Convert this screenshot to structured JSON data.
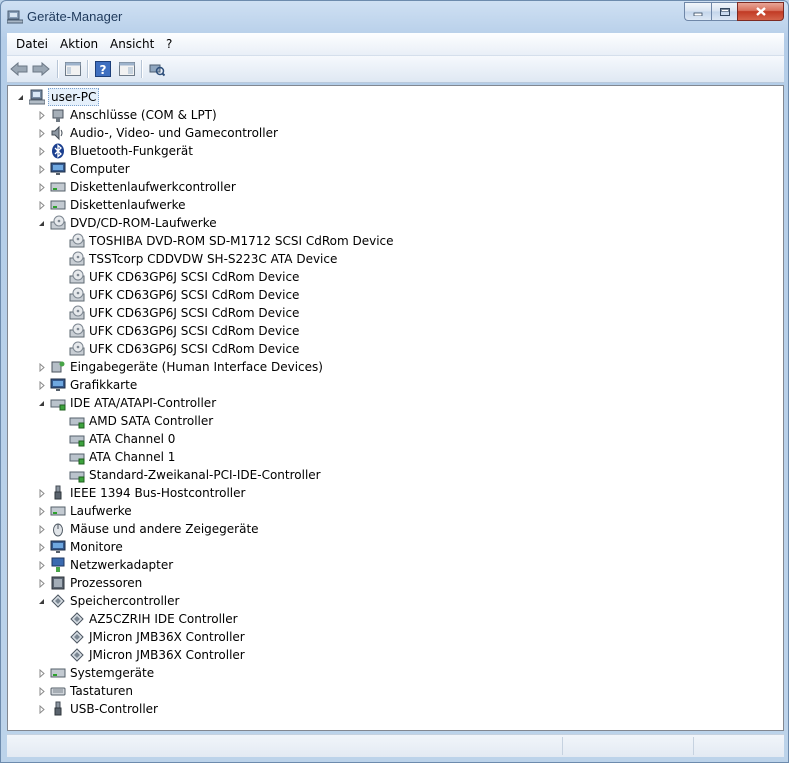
{
  "window": {
    "title": "Geräte-Manager"
  },
  "menu": [
    "Datei",
    "Aktion",
    "Ansicht",
    "?"
  ],
  "toolbar": [
    "back-icon",
    "forward-icon",
    "properties-pane-icon",
    "help-icon",
    "show-hide-console-tree-icon",
    "scan-hardware-icon"
  ],
  "tree": {
    "root": "user-PC",
    "categories": [
      {
        "label": "Anschlüsse (COM & LPT)",
        "icon": "port-icon",
        "expanded": false,
        "children": []
      },
      {
        "label": "Audio-, Video- und Gamecontroller",
        "icon": "speaker-icon",
        "expanded": false,
        "children": []
      },
      {
        "label": "Bluetooth-Funkgerät",
        "icon": "bluetooth-icon",
        "expanded": false,
        "children": []
      },
      {
        "label": "Computer",
        "icon": "computer-icon",
        "expanded": false,
        "children": []
      },
      {
        "label": "Diskettenlaufwerkcontroller",
        "icon": "floppy-controller-icon",
        "expanded": false,
        "children": []
      },
      {
        "label": "Diskettenlaufwerke",
        "icon": "floppy-drive-icon",
        "expanded": false,
        "children": []
      },
      {
        "label": "DVD/CD-ROM-Laufwerke",
        "icon": "dvd-drive-icon",
        "expanded": true,
        "children": [
          "TOSHIBA DVD-ROM SD-M1712 SCSI CdRom Device",
          "TSSTcorp CDDVDW SH-S223C ATA Device",
          "UFK CD63GP6J SCSI CdRom Device",
          "UFK CD63GP6J SCSI CdRom Device",
          "UFK CD63GP6J SCSI CdRom Device",
          "UFK CD63GP6J SCSI CdRom Device",
          "UFK CD63GP6J SCSI CdRom Device"
        ]
      },
      {
        "label": "Eingabegeräte (Human Interface Devices)",
        "icon": "hid-icon",
        "expanded": false,
        "children": []
      },
      {
        "label": "Grafikkarte",
        "icon": "display-adapter-icon",
        "expanded": false,
        "children": []
      },
      {
        "label": "IDE ATA/ATAPI-Controller",
        "icon": "ide-controller-icon",
        "expanded": true,
        "children": [
          "AMD SATA Controller",
          "ATA Channel 0",
          "ATA Channel 1",
          "Standard-Zweikanal-PCI-IDE-Controller"
        ]
      },
      {
        "label": "IEEE 1394 Bus-Hostcontroller",
        "icon": "firewire-icon",
        "expanded": false,
        "children": []
      },
      {
        "label": "Laufwerke",
        "icon": "disk-drive-icon",
        "expanded": false,
        "children": []
      },
      {
        "label": "Mäuse und andere Zeigegeräte",
        "icon": "mouse-icon",
        "expanded": false,
        "children": []
      },
      {
        "label": "Monitore",
        "icon": "monitor-icon",
        "expanded": false,
        "children": []
      },
      {
        "label": "Netzwerkadapter",
        "icon": "network-adapter-icon",
        "expanded": false,
        "children": []
      },
      {
        "label": "Prozessoren",
        "icon": "processor-icon",
        "expanded": false,
        "children": []
      },
      {
        "label": "Speichercontroller",
        "icon": "storage-controller-icon",
        "expanded": true,
        "children": [
          "AZ5CZRIH IDE Controller",
          "JMicron JMB36X Controller",
          "JMicron JMB36X Controller"
        ]
      },
      {
        "label": "Systemgeräte",
        "icon": "system-device-icon",
        "expanded": false,
        "children": []
      },
      {
        "label": "Tastaturen",
        "icon": "keyboard-icon",
        "expanded": false,
        "children": []
      },
      {
        "label": "USB-Controller",
        "icon": "usb-icon",
        "expanded": false,
        "children": []
      }
    ]
  }
}
